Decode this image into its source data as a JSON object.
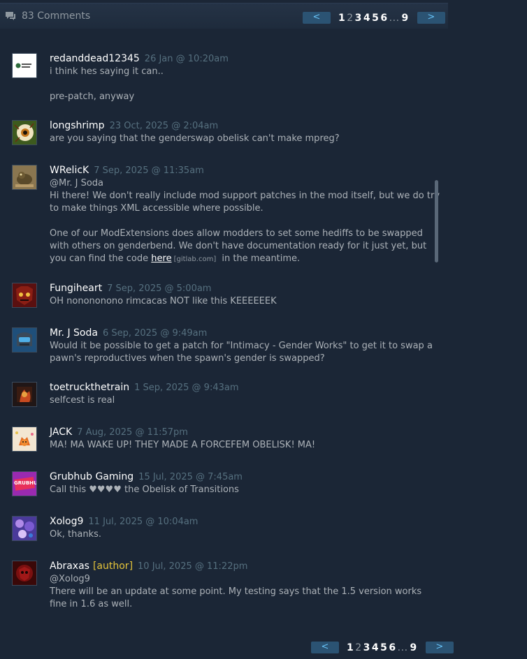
{
  "header": {
    "comment_count": "83 Comments"
  },
  "pager": {
    "prev": "<",
    "next": ">",
    "pages": [
      "1",
      "2",
      "3",
      "4",
      "5",
      "6",
      "9"
    ],
    "ellipsis": "...",
    "current": "2"
  },
  "comments": [
    {
      "author": "redanddead12345",
      "time": "26 Jan @ 10:20am",
      "avatar_icon": "games-for-windows-avatar",
      "lines": [
        "i think hes saying it can..",
        "",
        "pre-patch, anyway"
      ]
    },
    {
      "author": "longshrimp",
      "time": "23 Oct, 2025 @ 2:04am",
      "avatar_icon": "eyeball-avatar",
      "lines": [
        "are you saying that the genderswap obelisk can't make mpreg?"
      ]
    },
    {
      "author": "WRelicK",
      "time": "7 Sep, 2025 @ 11:35am",
      "avatar_icon": "creature-avatar",
      "line1": "@Mr. J Soda",
      "line2": "Hi there! We don't really include mod support patches in the mod itself, but we do try to make things XML accessible where possible.",
      "line3": "One of our ModExtensions does allow modders to set some hediffs to be swapped with others on genderbend. We don't have documentation ready for it just yet, but you can find the code",
      "link_text": "here",
      "link_domain": "[gitlab.com]",
      "line4": "in the meantime."
    },
    {
      "author": "Fungiheart",
      "time": "7 Sep, 2025 @ 5:00am",
      "avatar_icon": "red-mask-avatar",
      "lines": [
        "OH nonononono rimcacas NOT like this KEEEEEEK"
      ]
    },
    {
      "author": "Mr. J Soda",
      "time": "6 Sep, 2025 @ 9:49am",
      "avatar_icon": "helmet-avatar",
      "lines": [
        "Would it be possible to get a patch for \"Intimacy - Gender Works\" to get it to swap a pawn's reproductives when the spawn's gender is swapped?"
      ]
    },
    {
      "author": "toetruckthetrain",
      "time": "1 Sep, 2025 @ 9:43am",
      "avatar_icon": "fire-avatar",
      "lines": [
        "selfcest is real"
      ]
    },
    {
      "author": "JACK",
      "time": "7 Aug, 2025 @ 11:57pm",
      "avatar_icon": "fox-avatar",
      "lines": [
        "MA! MA WAKE UP! THEY MADE A FORCEFEM OBELISK! MA!"
      ]
    },
    {
      "author": "Grubhub Gaming",
      "time": "15 Jul, 2025 @ 7:45am",
      "avatar_icon": "grubhub-avatar",
      "avatar_label": "GRUBHUB",
      "lines": [
        "Call this ♥♥♥♥ the Obelisk of Transitions"
      ]
    },
    {
      "author": "Xolog9",
      "time": "11 Jul, 2025 @ 10:04am",
      "avatar_icon": "purple-art-avatar",
      "lines": [
        "Ok, thanks."
      ]
    },
    {
      "author": "Abraxas",
      "badge": "[author]",
      "time": "10 Jul, 2025 @ 11:22pm",
      "avatar_icon": "dark-red-avatar",
      "lines": [
        "@Xolog9",
        "There will be an update at some point. My testing says that the 1.5 version works fine in 1.6 as well."
      ]
    }
  ]
}
